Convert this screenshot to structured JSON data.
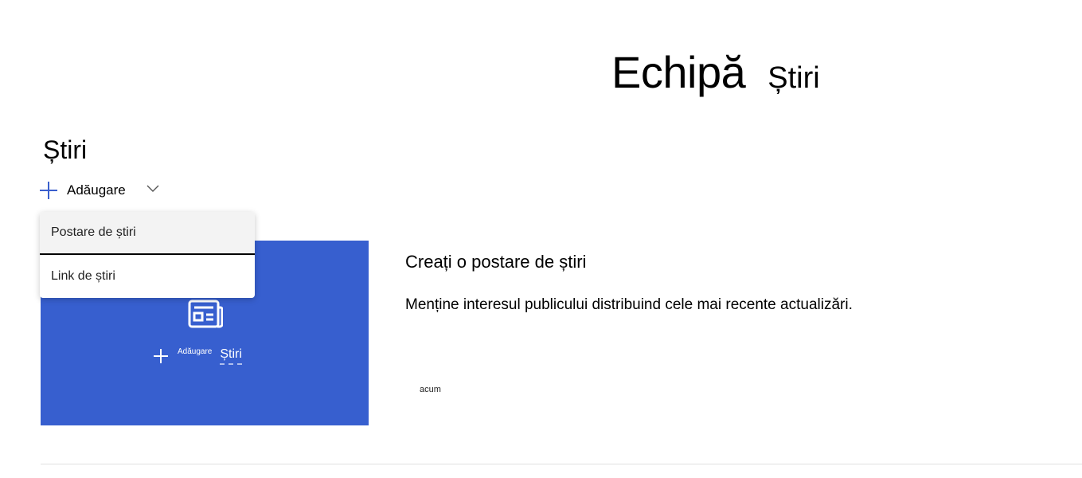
{
  "header": {
    "title_main": "Echipă",
    "title_sub": "Știri"
  },
  "news_section": {
    "title": "Știri",
    "add_button_label": "Adăugare"
  },
  "dropdown": {
    "items": [
      {
        "label": "Postare de știri"
      },
      {
        "label": "Link de știri"
      }
    ]
  },
  "card": {
    "add_small_label": "Adăugare",
    "add_news_label": "Știri",
    "color": "#375fcf"
  },
  "info": {
    "title": "Creați o postare de știri",
    "description": "Menține interesul publicului distribuind cele mai recente actualizări.",
    "timestamp": "acum"
  },
  "colors": {
    "accent": "#3a5fcd",
    "card_background": "#375fcf"
  }
}
